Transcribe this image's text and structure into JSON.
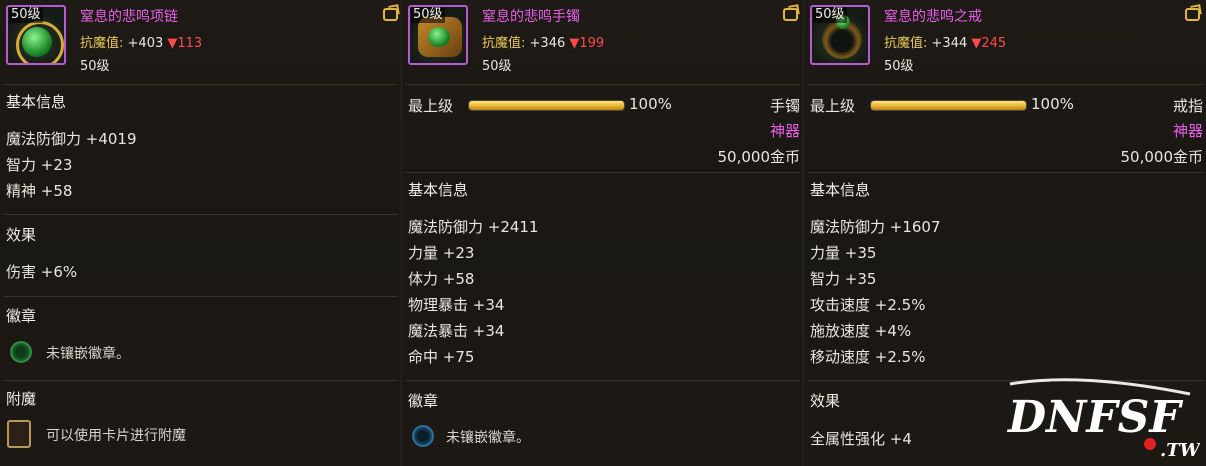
{
  "items": [
    {
      "level_tag": "50级",
      "name": "窒息的悲鸣项链",
      "resist_label": "抗魔值:",
      "resist_value": "+403",
      "resist_down": "▼113",
      "level": "50级",
      "basic_title": "基本信息",
      "stats": [
        "魔法防御力 +4019",
        "智力 +23",
        "精神 +58"
      ],
      "effect_title": "效果",
      "effect": "伤害 +6%",
      "emblem_title": "徽章",
      "emblem_text": "未镶嵌徽章。",
      "enchant_title": "附魔",
      "enchant_text": "可以使用卡片进行附魔"
    },
    {
      "level_tag": "50级",
      "name": "窒息的悲鸣手镯",
      "resist_label": "抗魔值:",
      "resist_value": "+346",
      "resist_down": "▼199",
      "level": "50级",
      "grade_label": "最上级",
      "grade_percent": "100%",
      "grade_fraction": 1.0,
      "slot_type": "手镯",
      "rarity": "神器",
      "price": "50,000金币",
      "basic_title": "基本信息",
      "stats": [
        "魔法防御力 +2411",
        "力量 +23",
        "体力 +58",
        "物理暴击 +34",
        "魔法暴击 +34",
        "命中 +75"
      ],
      "emblem_title": "徽章",
      "emblem_text": "未镶嵌徽章。"
    },
    {
      "level_tag": "50级",
      "name": "窒息的悲鸣之戒",
      "resist_label": "抗魔值:",
      "resist_value": "+344",
      "resist_down": "▼245",
      "level": "50级",
      "grade_label": "最上级",
      "grade_percent": "100%",
      "grade_fraction": 1.0,
      "slot_type": "戒指",
      "rarity": "神器",
      "price": "50,000金币",
      "basic_title": "基本信息",
      "stats": [
        "魔法防御力 +1607",
        "力量 +35",
        "智力 +35",
        "攻击速度 +2.5%",
        "施放速度 +4%",
        "移动速度 +2.5%"
      ],
      "effect_title": "效果",
      "effect": "全属性强化 +4"
    }
  ],
  "watermark": {
    "text_main": "DNFSF",
    "text_sub": ".TW"
  },
  "colors": {
    "rarity_pink": "#e65fe6",
    "resist_gold": "#e9c955",
    "down_red": "#ff4a4a",
    "bar_gold": "#e8b52b"
  },
  "icons": [
    "necklace-icon",
    "bracelet-icon",
    "ring-icon",
    "lock-icon",
    "emblem-slot-icon",
    "card-slot-icon"
  ]
}
